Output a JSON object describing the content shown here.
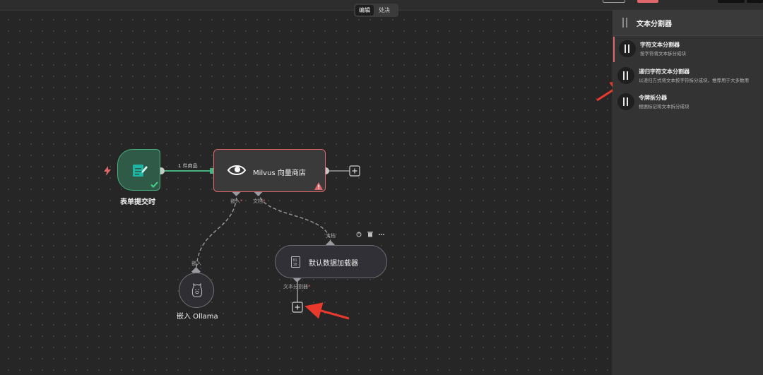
{
  "toolbar": {
    "mode_edit": "编辑",
    "mode_run": "处决"
  },
  "canvas": {
    "nodes": {
      "trigger": {
        "title": "表单提交时"
      },
      "milvus": {
        "title": "Milvus 向量商店"
      },
      "loader": {
        "title": "默认数据加载器"
      },
      "ollama": {
        "title": "嵌入 Ollama"
      }
    },
    "edges": {
      "trigger_to_milvus_label": "1 件商品"
    },
    "ports": {
      "milvus_embed": "嵌入",
      "milvus_document": "文档",
      "loader_document": "文档",
      "loader_text_splitter": "文本分割器",
      "ollama_embed": "嵌入",
      "required_mark": "*"
    }
  },
  "side_panel": {
    "title": "文本分割器",
    "items": [
      {
        "title": "字符文本分割器",
        "desc": "按字符将文本拆分成块"
      },
      {
        "title": "递归字符文本分割器",
        "desc": "以递归方式将文本按字符拆分成块，推荐用于大多数用"
      },
      {
        "title": "令牌拆分器",
        "desc": "根据标记将文本拆分成块"
      }
    ]
  },
  "colors": {
    "accent": "#e0676a",
    "trigger_green": "#46b27f",
    "canvas_bg": "#262626",
    "panel_bg": "#333333",
    "arrow_red": "#e8392c"
  }
}
